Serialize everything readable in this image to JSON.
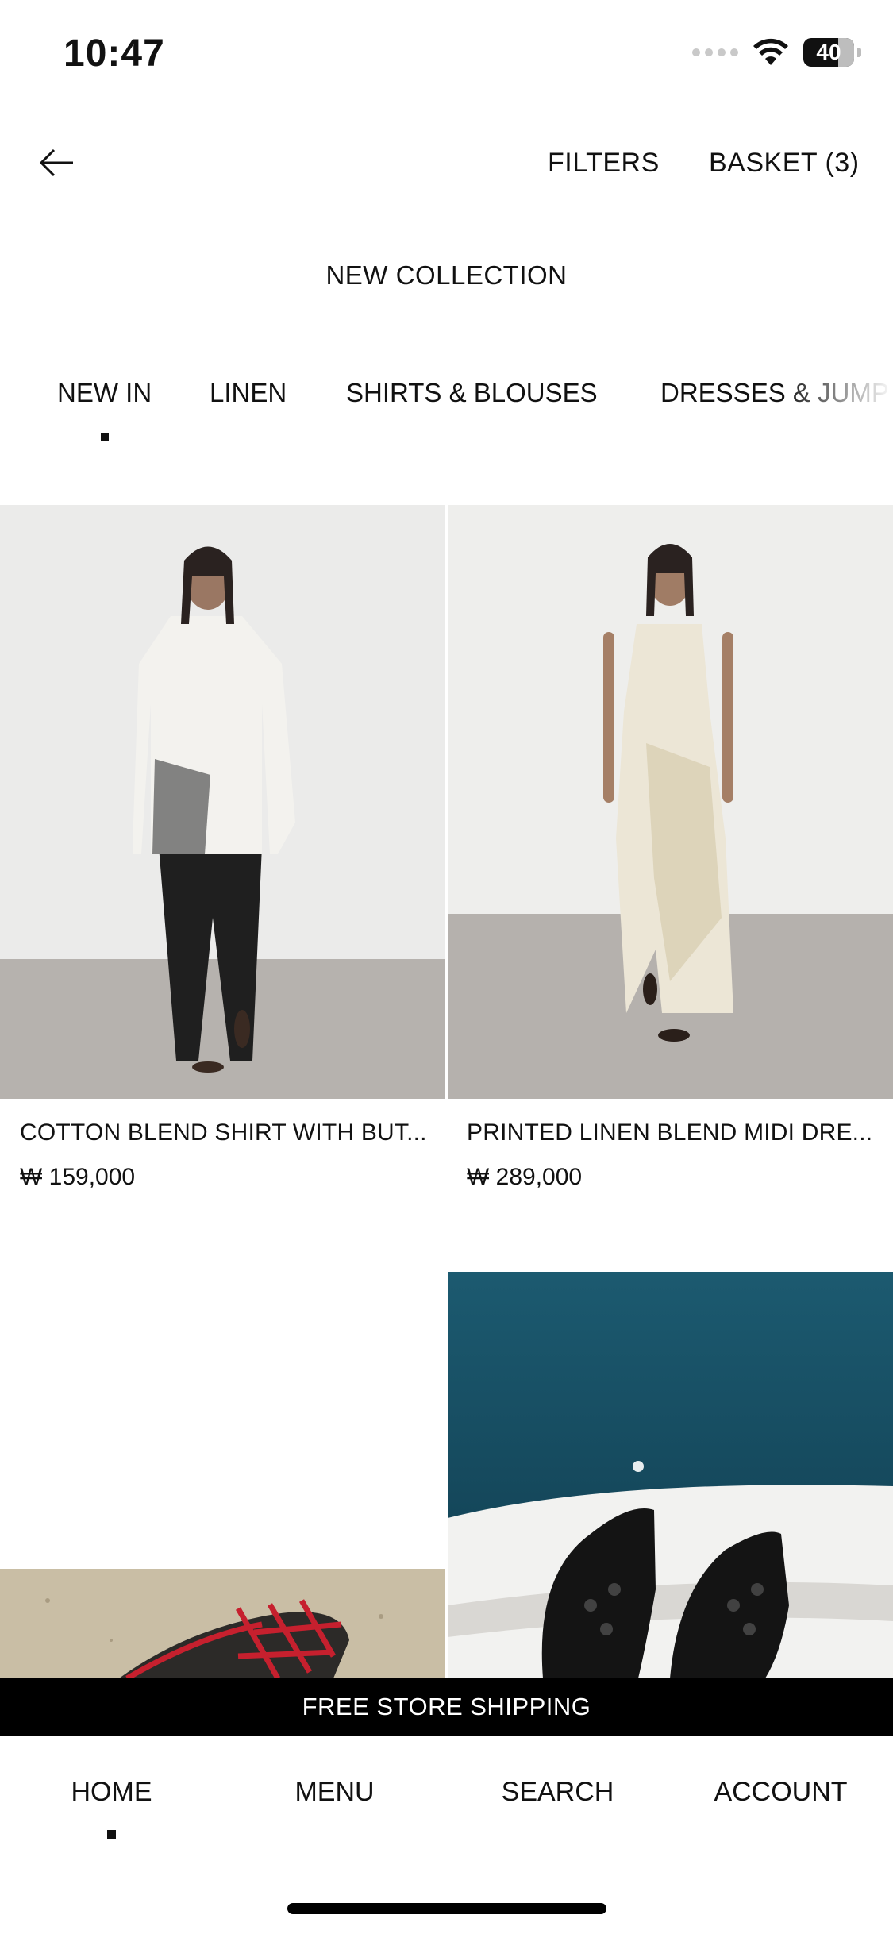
{
  "status_bar": {
    "time": "10:47",
    "battery": "40"
  },
  "header": {
    "back_icon": "arrow-left-icon",
    "filters_label": "FILTERS",
    "basket_label": "BASKET (3)"
  },
  "page_title": "NEW COLLECTION",
  "tabs": [
    {
      "label": "NEW IN",
      "selected": true
    },
    {
      "label": "LINEN"
    },
    {
      "label": "SHIRTS & BLOUSES"
    },
    {
      "label": "DRESSES & JUMP"
    }
  ],
  "products": [
    {
      "title": "COTTON BLEND SHIRT WITH BUT...",
      "price": "₩ 159,000"
    },
    {
      "title": "PRINTED LINEN BLEND MIDI DRE...",
      "price": "₩ 289,000"
    }
  ],
  "banner": "FREE STORE SHIPPING",
  "bottom_nav": [
    {
      "label": "HOME",
      "selected": true
    },
    {
      "label": "MENU"
    },
    {
      "label": "SEARCH"
    },
    {
      "label": "ACCOUNT"
    }
  ],
  "colors": {
    "text": "#111111",
    "banner_bg": "#000000",
    "banner_text": "#ffffff"
  }
}
